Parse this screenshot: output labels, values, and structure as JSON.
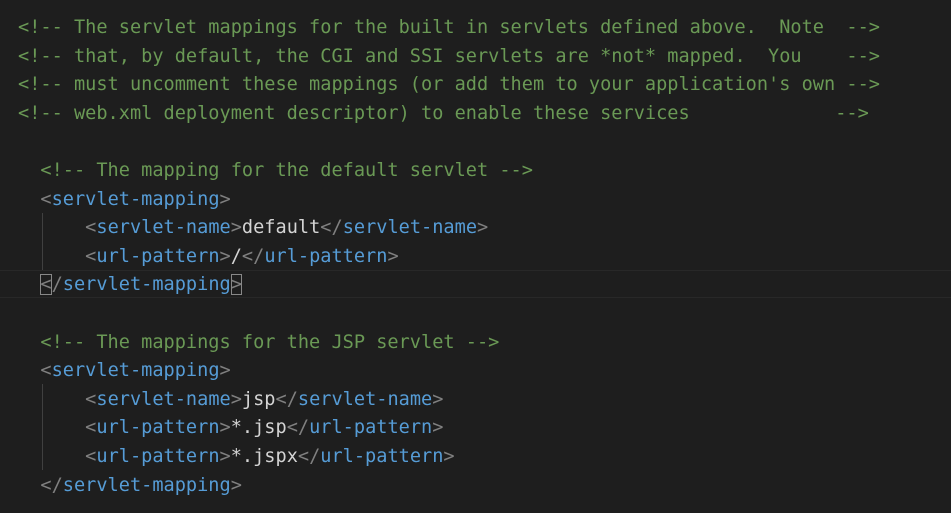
{
  "editor": {
    "lines": [
      {
        "indent": "",
        "tokens": [
          {
            "t": "comment",
            "v": "<!-- The servlet mappings for the built in servlets defined above.  Note  -->"
          }
        ]
      },
      {
        "indent": "",
        "tokens": [
          {
            "t": "comment",
            "v": "<!-- that, by default, the CGI and SSI servlets are *not* mapped.  You    -->"
          }
        ]
      },
      {
        "indent": "",
        "tokens": [
          {
            "t": "comment",
            "v": "<!-- must uncomment these mappings (or add them to your application's own -->"
          }
        ]
      },
      {
        "indent": "",
        "tokens": [
          {
            "t": "comment",
            "v": "<!-- web.xml deployment descriptor) to enable these services             -->"
          }
        ]
      },
      {
        "indent": "",
        "tokens": []
      },
      {
        "indent": "  ",
        "tokens": [
          {
            "t": "comment",
            "v": "<!-- The mapping for the default servlet -->"
          }
        ]
      },
      {
        "indent": "  ",
        "tokens": [
          {
            "t": "bracket",
            "v": "<"
          },
          {
            "t": "tag",
            "v": "servlet-mapping"
          },
          {
            "t": "bracket",
            "v": ">"
          }
        ]
      },
      {
        "indent": "      ",
        "tokens": [
          {
            "t": "bracket",
            "v": "<"
          },
          {
            "t": "tag",
            "v": "servlet-name"
          },
          {
            "t": "bracket",
            "v": ">"
          },
          {
            "t": "text",
            "v": "default"
          },
          {
            "t": "bracket",
            "v": "</"
          },
          {
            "t": "tag",
            "v": "servlet-name"
          },
          {
            "t": "bracket",
            "v": ">"
          }
        ]
      },
      {
        "indent": "      ",
        "tokens": [
          {
            "t": "bracket",
            "v": "<"
          },
          {
            "t": "tag",
            "v": "url-pattern"
          },
          {
            "t": "bracket",
            "v": ">"
          },
          {
            "t": "text",
            "v": "/"
          },
          {
            "t": "bracket",
            "v": "</"
          },
          {
            "t": "tag",
            "v": "url-pattern"
          },
          {
            "t": "bracket",
            "v": ">"
          }
        ]
      },
      {
        "indent": "  ",
        "tokens": [
          {
            "t": "bracket",
            "v": "<",
            "box": true
          },
          {
            "t": "bracket",
            "v": "/"
          },
          {
            "t": "tag",
            "v": "servlet-mapping"
          },
          {
            "t": "bracket",
            "v": ">",
            "box": true
          }
        ]
      },
      {
        "indent": "",
        "tokens": []
      },
      {
        "indent": "  ",
        "tokens": [
          {
            "t": "comment",
            "v": "<!-- The mappings for the JSP servlet -->"
          }
        ]
      },
      {
        "indent": "  ",
        "tokens": [
          {
            "t": "bracket",
            "v": "<"
          },
          {
            "t": "tag",
            "v": "servlet-mapping"
          },
          {
            "t": "bracket",
            "v": ">"
          }
        ]
      },
      {
        "indent": "      ",
        "tokens": [
          {
            "t": "bracket",
            "v": "<"
          },
          {
            "t": "tag",
            "v": "servlet-name"
          },
          {
            "t": "bracket",
            "v": ">"
          },
          {
            "t": "text",
            "v": "jsp"
          },
          {
            "t": "bracket",
            "v": "</"
          },
          {
            "t": "tag",
            "v": "servlet-name"
          },
          {
            "t": "bracket",
            "v": ">"
          }
        ]
      },
      {
        "indent": "      ",
        "tokens": [
          {
            "t": "bracket",
            "v": "<"
          },
          {
            "t": "tag",
            "v": "url-pattern"
          },
          {
            "t": "bracket",
            "v": ">"
          },
          {
            "t": "text",
            "v": "*.jsp"
          },
          {
            "t": "bracket",
            "v": "</"
          },
          {
            "t": "tag",
            "v": "url-pattern"
          },
          {
            "t": "bracket",
            "v": ">"
          }
        ]
      },
      {
        "indent": "      ",
        "tokens": [
          {
            "t": "bracket",
            "v": "<"
          },
          {
            "t": "tag",
            "v": "url-pattern"
          },
          {
            "t": "bracket",
            "v": ">"
          },
          {
            "t": "text",
            "v": "*.jspx"
          },
          {
            "t": "bracket",
            "v": "</"
          },
          {
            "t": "tag",
            "v": "url-pattern"
          },
          {
            "t": "bracket",
            "v": ">"
          }
        ]
      },
      {
        "indent": "  ",
        "tokens": [
          {
            "t": "bracket",
            "v": "</"
          },
          {
            "t": "tag",
            "v": "servlet-mapping"
          },
          {
            "t": "bracket",
            "v": ">"
          }
        ]
      }
    ]
  }
}
